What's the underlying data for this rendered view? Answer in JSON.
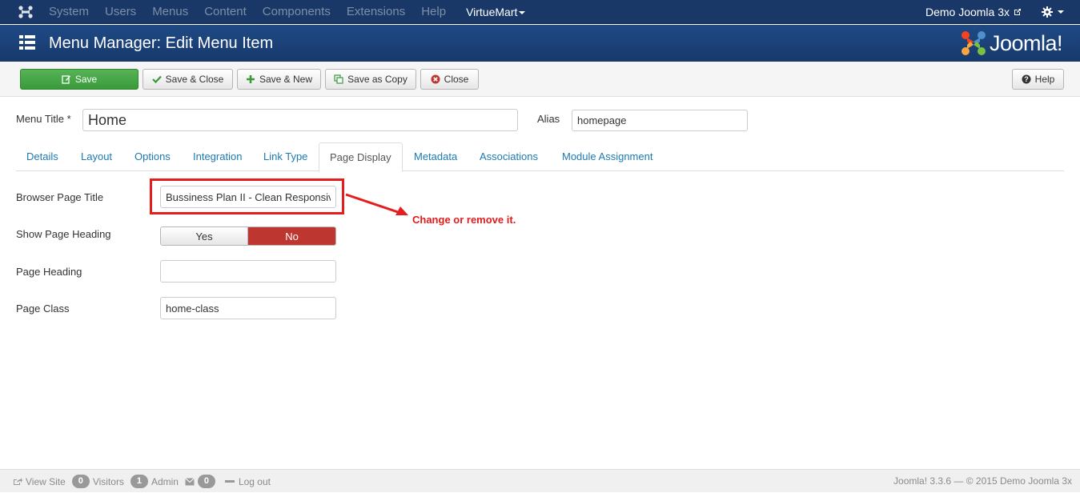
{
  "navbar": {
    "items": [
      "System",
      "Users",
      "Menus",
      "Content",
      "Components",
      "Extensions",
      "Help"
    ],
    "active_item": "VirtueMart",
    "site_name": "Demo Joomla 3x"
  },
  "header": {
    "title": "Menu Manager: Edit Menu Item",
    "brand": "Joomla!"
  },
  "toolbar": {
    "save": "Save",
    "save_close": "Save & Close",
    "save_new": "Save & New",
    "save_copy": "Save as Copy",
    "close": "Close",
    "help": "Help"
  },
  "form": {
    "menu_title_label": "Menu Title *",
    "menu_title_value": "Home",
    "alias_label": "Alias",
    "alias_value": "homepage"
  },
  "tabs": [
    "Details",
    "Layout",
    "Options",
    "Integration",
    "Link Type",
    "Page Display",
    "Metadata",
    "Associations",
    "Module Assignment"
  ],
  "active_tab": "Page Display",
  "page_display": {
    "browser_title_label": "Browser Page Title",
    "browser_title_value": "Bussiness Plan II - Clean Responsive",
    "show_heading_label": "Show Page Heading",
    "yes": "Yes",
    "no": "No",
    "page_heading_label": "Page Heading",
    "page_heading_value": "",
    "page_class_label": "Page Class",
    "page_class_value": "home-class"
  },
  "annotation": "Change or remove it.",
  "footer": {
    "view_site": "View Site",
    "visitors_count": "0",
    "visitors": "Visitors",
    "admin_count": "1",
    "admin": "Admin",
    "messages_count": "0",
    "logout": "Log out",
    "version": "Joomla! 3.3.6 — © 2015 Demo Joomla 3x"
  },
  "colors": {
    "navbar": "#1a3867",
    "header": "#1f4a86",
    "save_green": "#46a546",
    "no_red": "#bd362f",
    "tab_link": "#1c7ab3",
    "annotation_red": "#e01c1c"
  }
}
